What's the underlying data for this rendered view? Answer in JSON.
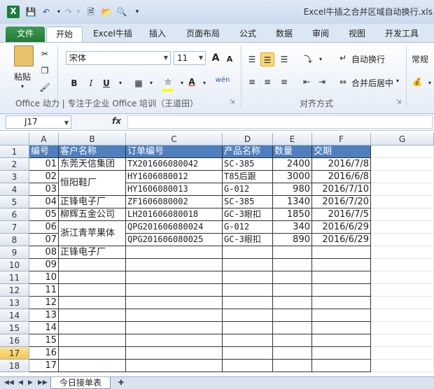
{
  "window": {
    "app_logo": "X",
    "title": "Excel牛插之合并区域自动换行.xls",
    "quick_access": [
      "save-icon",
      "undo-icon",
      "redo-icon",
      "new-icon",
      "open-icon",
      "print-preview-icon",
      "customize-icon"
    ]
  },
  "ribbon_tabs": [
    "文件",
    "开始",
    "Excel牛插",
    "插入",
    "页面布局",
    "公式",
    "数据",
    "审阅",
    "视图",
    "开发工具"
  ],
  "ribbon": {
    "paste_label": "粘贴",
    "font_name": "宋体",
    "font_size": "11",
    "bold": "B",
    "italic": "I",
    "underline": "U",
    "grow_font": "A",
    "shrink_font": "A",
    "font_color_letter": "A",
    "phonetic": "wén",
    "font_group_label": "Office 动力 | 专注于企业 Office 培训（王道田）",
    "wrap_text": "自动换行",
    "merge_center": "合并后居中",
    "align_group_label": "对齐方式",
    "number_format": "常规",
    "colors": {
      "fill_color": "#ffff00",
      "font_color": "#ff0000",
      "file_tab": "#237b37",
      "header_fill": "#4f7fbd",
      "selected_row": "#f6c84c"
    }
  },
  "formula_bar": {
    "name_box": "J17",
    "fx": "fx",
    "formula": ""
  },
  "sheet": {
    "columns": [
      "A",
      "B",
      "C",
      "D",
      "E",
      "F",
      "G"
    ],
    "row_numbers": [
      "1",
      "2",
      "3",
      "4",
      "5",
      "6",
      "7",
      "8",
      "9",
      "10",
      "11",
      "12",
      "13",
      "14",
      "15",
      "16",
      "17",
      "18"
    ],
    "selected_row": "17",
    "headers": [
      "编号",
      "客户名称",
      "订单编号",
      "产品名称",
      "数量",
      "交期"
    ],
    "rows": [
      [
        "01",
        "东莞天信集团",
        "TX201606080042",
        "SC-385",
        "2400",
        "2016/7/8"
      ],
      [
        "02",
        "",
        "HY1606080012",
        "T85后跟",
        "3000",
        "2016/6/8"
      ],
      [
        "03",
        "",
        "HY1606080013",
        "G-012",
        "980",
        "2016/7/10"
      ],
      [
        "04",
        "正锋电子厂",
        "ZF1606080002",
        "SC-385",
        "1340",
        "2016/7/20"
      ],
      [
        "05",
        "柳辉五金公司",
        "LH201606080018",
        "GC-3眼扣",
        "1850",
        "2016/7/5"
      ],
      [
        "06",
        "",
        "QPG201606080024",
        "G-012",
        "340",
        "2016/6/29"
      ],
      [
        "07",
        "",
        "QPG201606080025",
        "GC-3眼扣",
        "890",
        "2016/6/29"
      ],
      [
        "08",
        "正锋电子厂",
        "",
        "",
        "",
        ""
      ],
      [
        "09",
        "",
        "",
        "",
        "",
        ""
      ],
      [
        "10",
        "",
        "",
        "",
        "",
        ""
      ],
      [
        "11",
        "",
        "",
        "",
        "",
        ""
      ],
      [
        "12",
        "",
        "",
        "",
        "",
        ""
      ],
      [
        "13",
        "",
        "",
        "",
        "",
        ""
      ],
      [
        "14",
        "",
        "",
        "",
        "",
        ""
      ],
      [
        "15",
        "",
        "",
        "",
        "",
        ""
      ],
      [
        "16",
        "",
        "",
        "",
        "",
        ""
      ],
      [
        "17",
        "",
        "",
        "",
        "",
        ""
      ]
    ],
    "merged": {
      "hengyang": "恒阳鞋厂",
      "zhejiang": "浙江青苹果体"
    },
    "tab_name": "今日接单表"
  }
}
